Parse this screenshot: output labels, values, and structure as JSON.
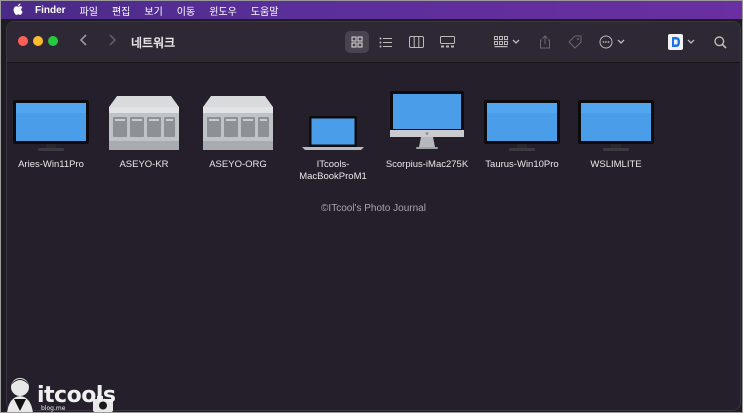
{
  "menubar": {
    "items": [
      "Finder",
      "파일",
      "편집",
      "보기",
      "이동",
      "윈도우",
      "도움말"
    ]
  },
  "window": {
    "title": "네트워크",
    "colors": {
      "close": "#ff5f57",
      "minimize": "#febc2e",
      "zoom": "#28c840",
      "background": "#241f2a"
    }
  },
  "toolbar": {
    "icons": [
      "back-icon",
      "forward-icon",
      "icon-view-icon",
      "list-view-icon",
      "column-view-icon",
      "gallery-view-icon",
      "group-icon",
      "share-icon",
      "tag-icon",
      "more-icon",
      "dropdown-app-icon",
      "search-icon"
    ]
  },
  "items": [
    {
      "label": "Aries-Win11Pro",
      "kind": "monitor"
    },
    {
      "label": "ASEYO-KR",
      "kind": "server"
    },
    {
      "label": "ASEYO-ORG",
      "kind": "server"
    },
    {
      "label": "ITcools-\nMacBookProM1",
      "kind": "laptop"
    },
    {
      "label": "Scorpius-iMac275K",
      "kind": "imac"
    },
    {
      "label": "Taurus-Win10Pro",
      "kind": "monitor"
    },
    {
      "label": "WSLIMLITE",
      "kind": "monitor"
    }
  ],
  "watermark": "©ITcool's Photo Journal",
  "logo": {
    "text": "itcools",
    "subtext": "blog.me"
  }
}
